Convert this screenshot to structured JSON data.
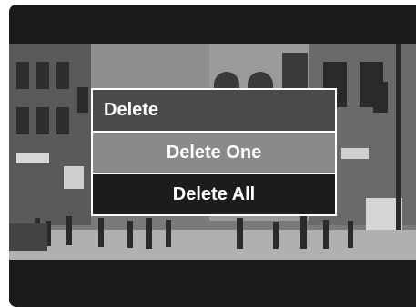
{
  "menu": {
    "title": "Delete",
    "items": [
      {
        "label": "Delete One",
        "state": "selected"
      },
      {
        "label": "Delete All",
        "state": "normal"
      }
    ]
  },
  "colors": {
    "screen_bg": "#1a1a1a",
    "title_bar": "#4a4a4a",
    "selected_item": "#8a8a8a",
    "normal_item": "#1c1c1c",
    "border": "#ffffff"
  }
}
